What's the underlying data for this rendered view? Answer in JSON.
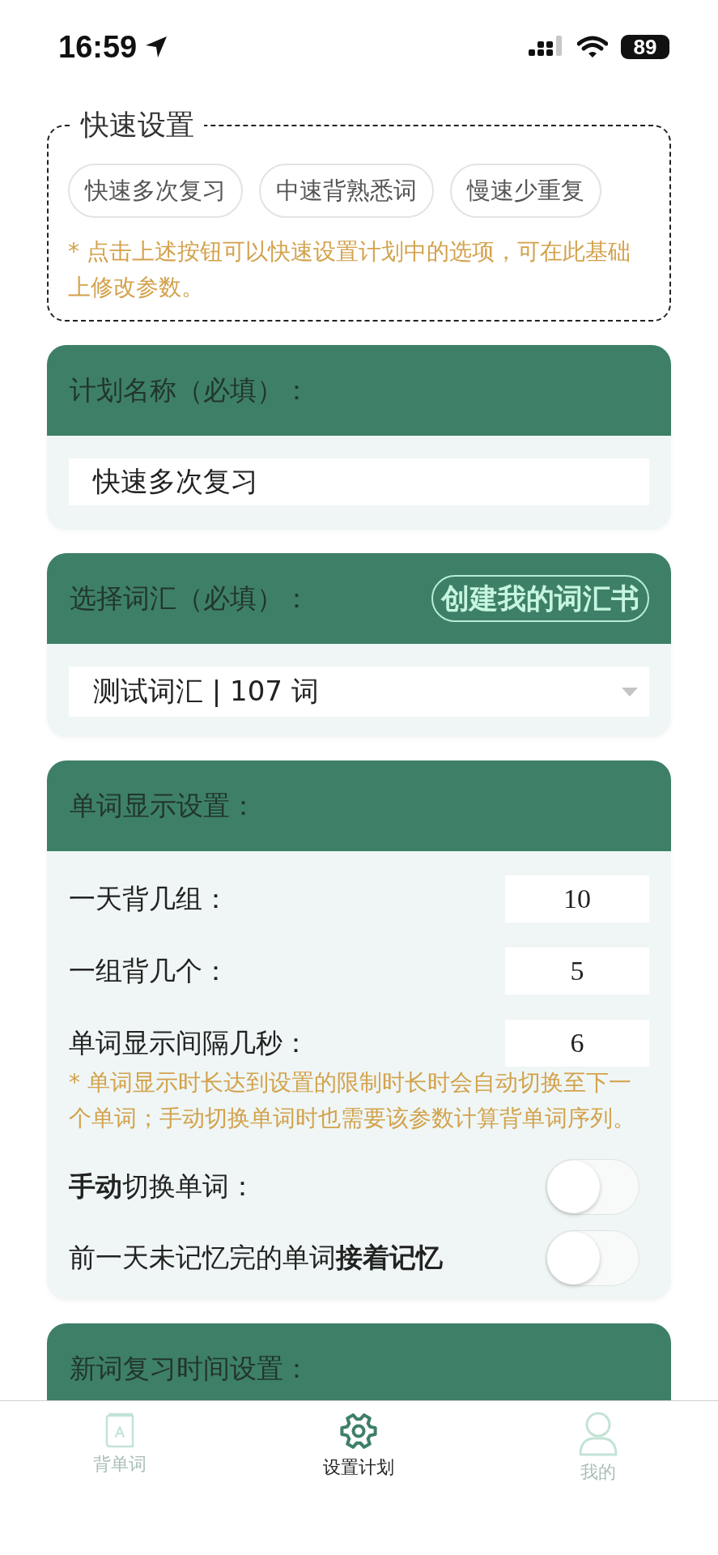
{
  "status_bar": {
    "time": "16:59",
    "battery": "89"
  },
  "quick_settings": {
    "title": "快速设置",
    "buttons": [
      "快速多次复习",
      "中速背熟悉词",
      "慢速少重复"
    ],
    "note": "* 点击上述按钮可以快速设置计划中的选项，可在此基础上修改参数。"
  },
  "plan_name": {
    "title": "计划名称（必填）：",
    "value": "快速多次复习"
  },
  "vocabulary": {
    "title": "选择词汇（必填）：",
    "button": "创建我的词汇书",
    "value": "测试词汇 | 107 词"
  },
  "display_settings": {
    "title": "单词显示设置：",
    "fields": [
      {
        "label": "一天背几组：",
        "value": "10"
      },
      {
        "label": "一组背几个：",
        "value": "5"
      },
      {
        "label": "单词显示间隔几秒：",
        "value": "6"
      }
    ],
    "note": "* 单词显示时长达到设置的限制时长时会自动切换至下一个单词；手动切换单词时也需要该参数计算背单词序列。",
    "toggles": [
      {
        "label": "**手动**切换单词：",
        "on": false
      },
      {
        "label": "前一天未记忆完的单词**接着记忆**",
        "on": false
      }
    ]
  },
  "review_settings": {
    "title": "新词复习时间设置："
  },
  "tab_bar": [
    {
      "label": "背单词",
      "selected": false
    },
    {
      "label": "设置计划",
      "selected": true
    },
    {
      "label": "我的",
      "selected": false
    }
  ]
}
